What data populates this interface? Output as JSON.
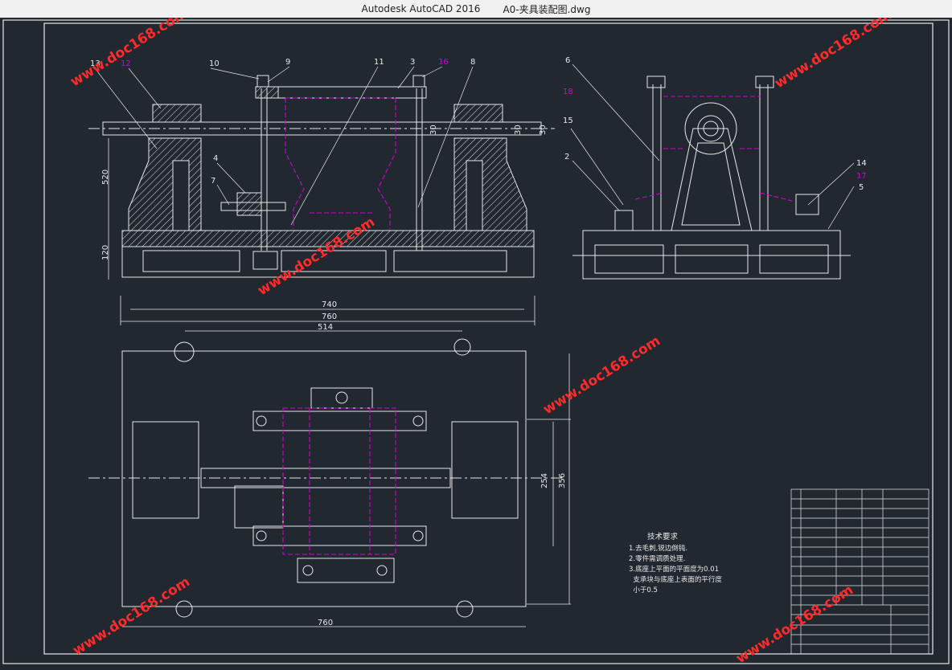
{
  "window": {
    "app": "Autodesk AutoCAD 2016",
    "file": "A0-夹具装配图.dwg"
  },
  "drawing": {
    "balloons": [
      "13",
      "12",
      "10",
      "9",
      "11",
      "3",
      "16",
      "8",
      "6",
      "18",
      "15",
      "2",
      "4",
      "7",
      "14",
      "17",
      "5"
    ],
    "dims": {
      "d740": "740",
      "d760_top": "760",
      "d514": "514",
      "d760_bottom": "760",
      "d254": "254",
      "d356": "356",
      "d120": "120",
      "d520": "520",
      "d30a": "30",
      "d30b": "30",
      "d30c": "30"
    },
    "notes": {
      "title": "技术要求",
      "lines": [
        "1.去毛刺,锐边倒钝.",
        "2.零件需调质处理.",
        "3.底座上平面的平面度为0.01",
        "  支承块与底座上表面的平行度",
        "  小于0.5"
      ]
    },
    "watermark": "www.doc168.com"
  },
  "colors": {
    "line": "#e8e8e8",
    "accent": "#d400d4",
    "watermark": "#ff2a2a"
  }
}
